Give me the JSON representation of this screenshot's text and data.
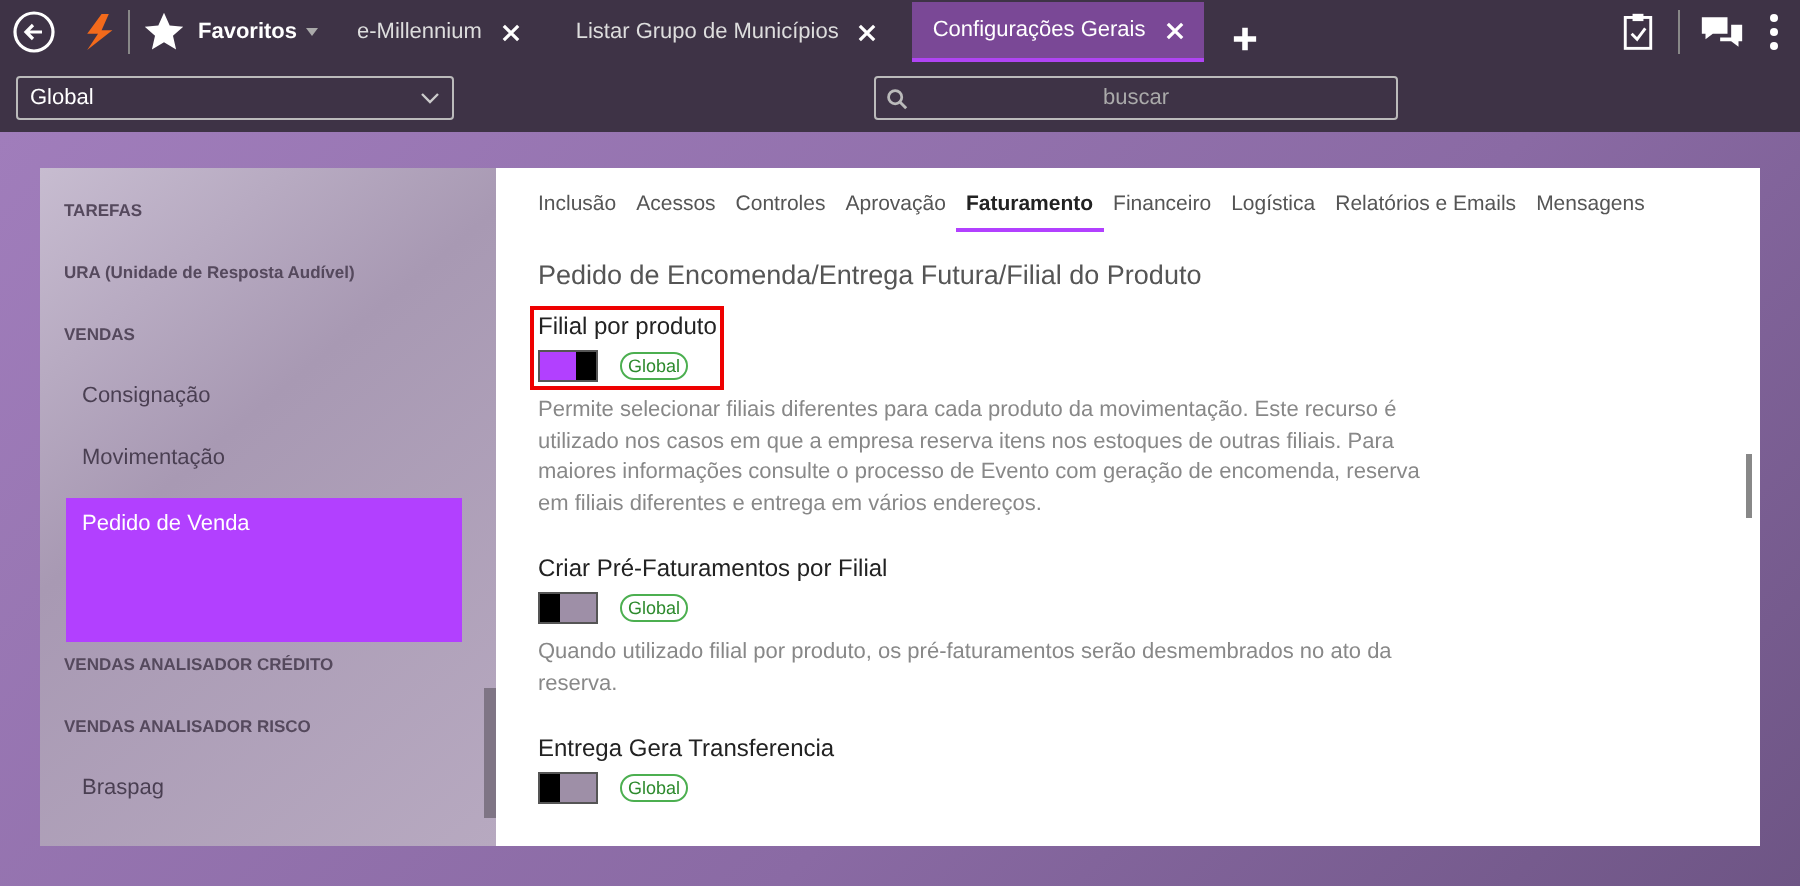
{
  "topbar": {
    "favorites": "Favoritos",
    "tabs": [
      {
        "label": "e-Millennium",
        "selected": false
      },
      {
        "label": "Listar Grupo de Municípios",
        "selected": false
      },
      {
        "label": "Configurações Gerais",
        "selected": true
      }
    ]
  },
  "scope_select": {
    "value": "Global"
  },
  "search": {
    "placeholder": "buscar"
  },
  "sidebar": {
    "items": [
      {
        "label": "TAREFAS",
        "kind": "header",
        "selected": false
      },
      {
        "label": "URA (Unidade de Resposta Audível)",
        "kind": "header",
        "selected": false
      },
      {
        "label": "VENDAS",
        "kind": "header",
        "selected": false
      },
      {
        "label": "Consignação",
        "kind": "item",
        "selected": false
      },
      {
        "label": "Movimentação",
        "kind": "item",
        "selected": false
      },
      {
        "label": "Pedido de Venda",
        "kind": "item",
        "selected": true
      },
      {
        "label": "VENDAS ANALISADOR CRÉDITO",
        "kind": "header",
        "selected": false
      },
      {
        "label": "VENDAS ANALISADOR RISCO",
        "kind": "header",
        "selected": false
      },
      {
        "label": "Braspag",
        "kind": "item",
        "selected": false
      }
    ]
  },
  "content_tabs": [
    {
      "label": "Inclusão",
      "selected": false
    },
    {
      "label": "Acessos",
      "selected": false
    },
    {
      "label": "Controles",
      "selected": false
    },
    {
      "label": "Aprovação",
      "selected": false
    },
    {
      "label": "Faturamento",
      "selected": true
    },
    {
      "label": "Financeiro",
      "selected": false
    },
    {
      "label": "Logística",
      "selected": false
    },
    {
      "label": "Relatórios e Emails",
      "selected": false
    },
    {
      "label": "Mensagens",
      "selected": false
    }
  ],
  "section_title": "Pedido de Encomenda/Entrega Futura/Filial do Produto",
  "settings": [
    {
      "label": "Filial por produto",
      "on": true,
      "highlighted": true,
      "scope": "Global",
      "description": "Permite selecionar filiais diferentes para cada produto da movimentação. Este recurso é utilizado nos casos em que a empresa reserva itens nos estoques de outras filiais. Para maiores informações consulte o processo de Evento com geração de encomenda, reserva em filiais diferentes e entrega em vários endereços."
    },
    {
      "label": "Criar Pré-Faturamentos por Filial",
      "on": false,
      "highlighted": false,
      "scope": "Global",
      "description": "Quando utilizado filial por produto, os pré-faturamentos serão desmembrados no ato da reserva."
    },
    {
      "label": "Entrega Gera Transferencia",
      "on": false,
      "highlighted": false,
      "scope": "Global"
    }
  ]
}
